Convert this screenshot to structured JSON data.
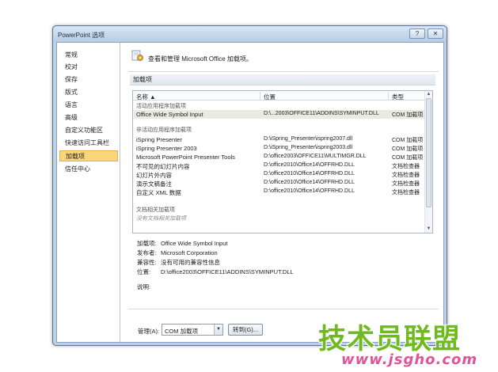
{
  "window": {
    "title": "PowerPoint 选项",
    "help_label": "?",
    "close_label": "✕"
  },
  "nav": {
    "items": [
      {
        "label": "常规"
      },
      {
        "label": "校对"
      },
      {
        "label": "保存"
      },
      {
        "label": "版式"
      },
      {
        "label": "语言"
      },
      {
        "label": "高级"
      },
      {
        "label": "自定义功能区"
      },
      {
        "label": "快速访问工具栏"
      },
      {
        "label": "加载项",
        "active": true
      },
      {
        "label": "信任中心"
      }
    ]
  },
  "header": {
    "icon": "addin-gear-icon",
    "text": "查看和管理 Microsoft Office 加载项。"
  },
  "section": {
    "title": "加载项"
  },
  "table": {
    "columns": [
      "名称 ▲",
      "位置",
      "类型"
    ],
    "groups": [
      {
        "label": "活动应用程序加载项",
        "rows": [
          {
            "name": "Office Wide Symbol Input",
            "location": "D:\\...2003\\OFFICE11\\ADDINS\\SYMINPUT.DLL",
            "type": "COM 加载项",
            "selected": true
          }
        ]
      },
      {
        "label": "非活动应用程序加载项",
        "rows": [
          {
            "name": "iSpring Presenter",
            "location": "D:\\iSpring_Presenter\\ispring2007.dll",
            "type": "COM 加载项"
          },
          {
            "name": "iSpring Presenter 2003",
            "location": "D:\\iSpring_Presenter\\ispring2003.dll",
            "type": "COM 加载项"
          },
          {
            "name": "Microsoft PowerPoint Presenter Tools",
            "location": "D:\\office2003\\OFFICE11\\MULTIMGR.DLL",
            "type": "COM 加载项"
          },
          {
            "name": "不可见的幻灯片内容",
            "location": "D:\\office2010\\Office14\\OFFRHD.DLL",
            "type": "文档检查器"
          },
          {
            "name": "幻灯片外内容",
            "location": "D:\\office2010\\Office14\\OFFRHD.DLL",
            "type": "文档检查器"
          },
          {
            "name": "演示文稿备注",
            "location": "D:\\office2010\\Office14\\OFFRHD.DLL",
            "type": "文档检查器"
          },
          {
            "name": "自定义 XML 数据",
            "location": "D:\\office2010\\Office14\\OFFRHD.DLL",
            "type": "文档检查器"
          }
        ]
      },
      {
        "label": "文档相关加载项",
        "empty_text": "没有文档相关加载项",
        "rows": []
      }
    ]
  },
  "details": {
    "addin_label": "加载项:",
    "addin_value": "Office Wide Symbol Input",
    "publisher_label": "发布者:",
    "publisher_value": "Microsoft Corporation",
    "compat_label": "兼容性:",
    "compat_value": "没有可用的兼容性信息",
    "location_label": "位置:",
    "location_value": "D:\\office2003\\OFFICE11\\ADDINS\\SYMINPUT.DLL",
    "description_label": "说明:"
  },
  "manage": {
    "label": "管理(A):",
    "selected": "COM 加载项",
    "go_label": "转到(G)..."
  },
  "watermark": {
    "main": "技术员联盟",
    "url": "www.jsgho.com"
  }
}
